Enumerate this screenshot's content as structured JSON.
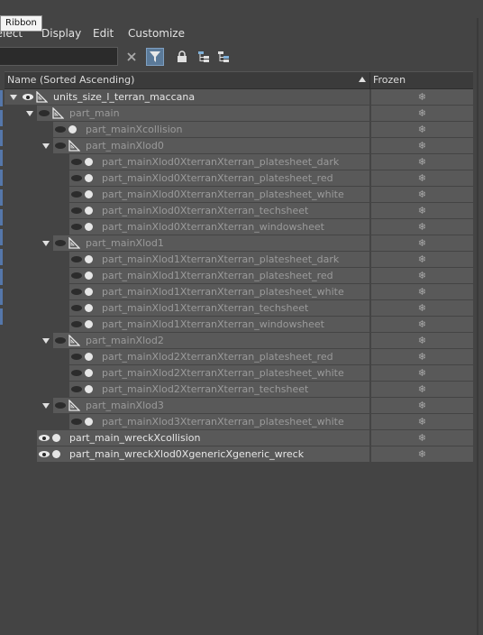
{
  "tooltip": {
    "text": "Ribbon"
  },
  "menu": {
    "select": "Select",
    "display": "Display",
    "edit": "Edit",
    "customize": "Customize"
  },
  "toolbar": {
    "search_value": "",
    "search_placeholder": ""
  },
  "columns": {
    "name": "Name (Sorted Ascending)",
    "frozen": "Frozen"
  },
  "icons": {
    "clear": "close-icon",
    "filter": "filter-icon",
    "lock": "lock-icon",
    "hierarchy": "hierarchy-icon",
    "hierarchy_alt": "hierarchy-alt-icon",
    "snowflake": "snowflake-icon"
  },
  "colors": {
    "accent": "#5b7a99",
    "selection_strip": "#5577aa",
    "row_bg": "#595959",
    "frozen_text": "#9a9a9a"
  },
  "tree": [
    {
      "label": "units_size_l_terran_maccana",
      "depth": 0,
      "kind": "bone",
      "expanded": true,
      "visible": true,
      "frozen_text": false,
      "frozen": "❄"
    },
    {
      "label": "part_main",
      "depth": 1,
      "kind": "bone",
      "expanded": true,
      "visible": false,
      "frozen_text": true,
      "frozen": "❄"
    },
    {
      "label": "part_mainXcollision",
      "depth": 2,
      "kind": "mesh",
      "expanded": null,
      "visible": false,
      "frozen_text": true,
      "frozen": "❄"
    },
    {
      "label": "part_mainXlod0",
      "depth": 2,
      "kind": "bone",
      "expanded": true,
      "visible": false,
      "frozen_text": true,
      "frozen": "❄"
    },
    {
      "label": "part_mainXlod0XterranXterran_platesheet_dark",
      "depth": 3,
      "kind": "mesh",
      "expanded": null,
      "visible": false,
      "frozen_text": true,
      "frozen": "❄"
    },
    {
      "label": "part_mainXlod0XterranXterran_platesheet_red",
      "depth": 3,
      "kind": "mesh",
      "expanded": null,
      "visible": false,
      "frozen_text": true,
      "frozen": "❄"
    },
    {
      "label": "part_mainXlod0XterranXterran_platesheet_white",
      "depth": 3,
      "kind": "mesh",
      "expanded": null,
      "visible": false,
      "frozen_text": true,
      "frozen": "❄"
    },
    {
      "label": "part_mainXlod0XterranXterran_techsheet",
      "depth": 3,
      "kind": "mesh",
      "expanded": null,
      "visible": false,
      "frozen_text": true,
      "frozen": "❄"
    },
    {
      "label": "part_mainXlod0XterranXterran_windowsheet",
      "depth": 3,
      "kind": "mesh",
      "expanded": null,
      "visible": false,
      "frozen_text": true,
      "frozen": "❄"
    },
    {
      "label": "part_mainXlod1",
      "depth": 2,
      "kind": "bone",
      "expanded": true,
      "visible": false,
      "frozen_text": true,
      "frozen": "❄"
    },
    {
      "label": "part_mainXlod1XterranXterran_platesheet_dark",
      "depth": 3,
      "kind": "mesh",
      "expanded": null,
      "visible": false,
      "frozen_text": true,
      "frozen": "❄"
    },
    {
      "label": "part_mainXlod1XterranXterran_platesheet_red",
      "depth": 3,
      "kind": "mesh",
      "expanded": null,
      "visible": false,
      "frozen_text": true,
      "frozen": "❄"
    },
    {
      "label": "part_mainXlod1XterranXterran_platesheet_white",
      "depth": 3,
      "kind": "mesh",
      "expanded": null,
      "visible": false,
      "frozen_text": true,
      "frozen": "❄"
    },
    {
      "label": "part_mainXlod1XterranXterran_techsheet",
      "depth": 3,
      "kind": "mesh",
      "expanded": null,
      "visible": false,
      "frozen_text": true,
      "frozen": "❄"
    },
    {
      "label": "part_mainXlod1XterranXterran_windowsheet",
      "depth": 3,
      "kind": "mesh",
      "expanded": null,
      "visible": false,
      "frozen_text": true,
      "frozen": "❄"
    },
    {
      "label": "part_mainXlod2",
      "depth": 2,
      "kind": "bone",
      "expanded": true,
      "visible": false,
      "frozen_text": true,
      "frozen": "❄"
    },
    {
      "label": "part_mainXlod2XterranXterran_platesheet_red",
      "depth": 3,
      "kind": "mesh",
      "expanded": null,
      "visible": false,
      "frozen_text": true,
      "frozen": "❄"
    },
    {
      "label": "part_mainXlod2XterranXterran_platesheet_white",
      "depth": 3,
      "kind": "mesh",
      "expanded": null,
      "visible": false,
      "frozen_text": true,
      "frozen": "❄"
    },
    {
      "label": "part_mainXlod2XterranXterran_techsheet",
      "depth": 3,
      "kind": "mesh",
      "expanded": null,
      "visible": false,
      "frozen_text": true,
      "frozen": "❄"
    },
    {
      "label": "part_mainXlod3",
      "depth": 2,
      "kind": "bone",
      "expanded": true,
      "visible": false,
      "frozen_text": true,
      "frozen": "❄"
    },
    {
      "label": "part_mainXlod3XterranXterran_platesheet_white",
      "depth": 3,
      "kind": "mesh",
      "expanded": null,
      "visible": false,
      "frozen_text": true,
      "frozen": "❄"
    },
    {
      "label": "part_main_wreckXcollision",
      "depth": 1,
      "kind": "mesh",
      "expanded": null,
      "visible": true,
      "frozen_text": false,
      "frozen": "❄"
    },
    {
      "label": "part_main_wreckXlod0XgenericXgeneric_wreck",
      "depth": 1,
      "kind": "mesh",
      "expanded": null,
      "visible": true,
      "frozen_text": false,
      "frozen": "❄"
    }
  ]
}
